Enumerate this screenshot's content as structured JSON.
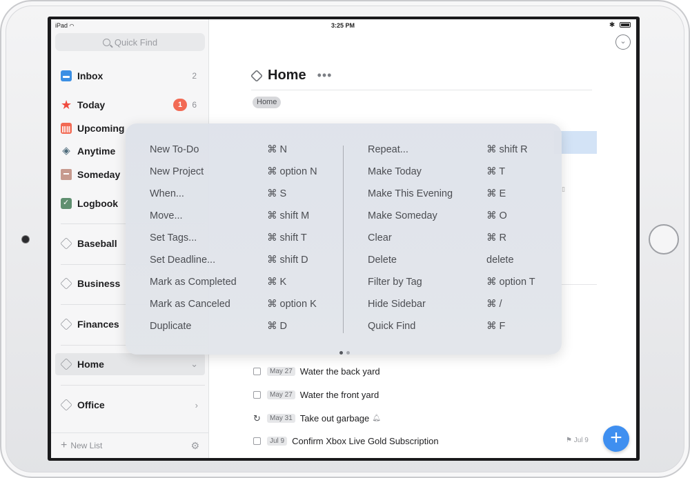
{
  "status_bar": {
    "device": "iPad",
    "time": "3:25 PM",
    "bluetooth": "✱"
  },
  "sidebar": {
    "quick_find_placeholder": "Quick Find",
    "items": [
      {
        "label": "Inbox",
        "count": "2"
      },
      {
        "label": "Today",
        "badge": "1",
        "count": "6"
      },
      {
        "label": "Upcoming"
      },
      {
        "label": "Anytime"
      },
      {
        "label": "Someday"
      },
      {
        "label": "Logbook"
      }
    ],
    "areas": [
      {
        "label": "Baseball"
      },
      {
        "label": "Business"
      },
      {
        "label": "Finances"
      },
      {
        "label": "Home"
      },
      {
        "label": "Office"
      }
    ],
    "footer": {
      "new_list": "New List"
    }
  },
  "main": {
    "project_title": "Home",
    "more": "•••",
    "tag": "Home",
    "tasks": [
      {
        "date": "May 27",
        "title": "Water the back yard"
      },
      {
        "date": "May 27",
        "title": "Water the front yard"
      },
      {
        "date": "May 31",
        "title": "Take out garbage"
      },
      {
        "date": "Jul 9",
        "title": "Confirm Xbox Live Gold Subscription",
        "deadline": "Jul 9"
      }
    ]
  },
  "shortcuts": {
    "left": [
      {
        "action": "New To-Do",
        "keys": "⌘ N"
      },
      {
        "action": "New Project",
        "keys": "⌘ option N"
      },
      {
        "action": "When...",
        "keys": "⌘ S"
      },
      {
        "action": "Move...",
        "keys": "⌘ shift M"
      },
      {
        "action": "Set Tags...",
        "keys": "⌘ shift T"
      },
      {
        "action": "Set Deadline...",
        "keys": "⌘ shift D"
      },
      {
        "action": "Mark as Completed",
        "keys": "⌘ K"
      },
      {
        "action": "Mark as Canceled",
        "keys": "⌘ option K"
      },
      {
        "action": "Duplicate",
        "keys": "⌘ D"
      }
    ],
    "right": [
      {
        "action": "Repeat...",
        "keys": "⌘ shift R"
      },
      {
        "action": "Make Today",
        "keys": "⌘ T"
      },
      {
        "action": "Make This Evening",
        "keys": "⌘ E"
      },
      {
        "action": "Make Someday",
        "keys": "⌘ O"
      },
      {
        "action": "Clear",
        "keys": "⌘ R"
      },
      {
        "action": "Delete",
        "keys": "delete"
      },
      {
        "action": "Filter by Tag",
        "keys": "⌘ option T"
      },
      {
        "action": "Hide Sidebar",
        "keys": "⌘ /"
      },
      {
        "action": "Quick Find",
        "keys": "⌘ F"
      }
    ]
  },
  "colors": {
    "accent": "#3f8ff0",
    "badge": "#f26a54",
    "today_star": "#f04b3f"
  }
}
